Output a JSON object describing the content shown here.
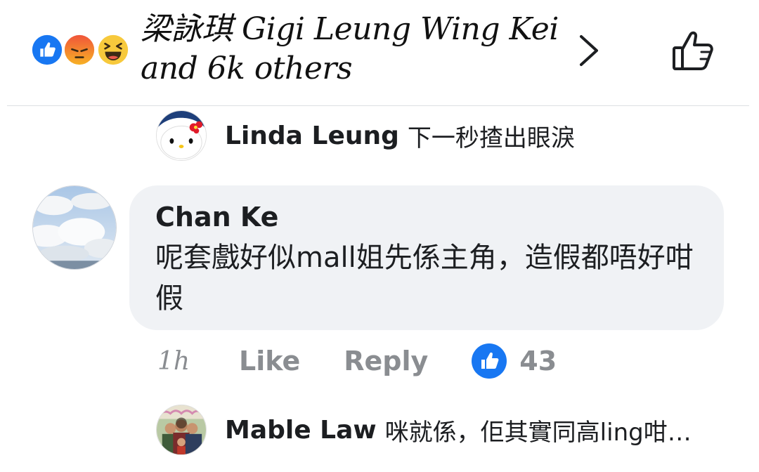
{
  "header": {
    "reactions": [
      "like",
      "angry",
      "haha"
    ],
    "reactors_text": "梁詠琪 Gigi Leung Wing Kei and 6k others",
    "next_icon": "chevron-right-icon",
    "like_icon": "thumbs-up-outline-icon"
  },
  "replies_top": {
    "name": "Linda Leung",
    "text": "下一秒揸出眼淚",
    "avatar": "hello-kitty-avatar"
  },
  "comment": {
    "author": "Chan Ke",
    "body": "呢套戲好似mall姐先係主角，造假都唔好咁假",
    "avatar": "sky-clouds-avatar"
  },
  "actions": {
    "time": "1h",
    "like_label": "Like",
    "reply_label": "Reply",
    "reaction_count": "43"
  },
  "replies_bottom": {
    "name": "Mable Law",
    "text": "咪就係，佢其實同高ling咁…",
    "avatar": "family-photo-avatar"
  },
  "colors": {
    "facebook_blue": "#1877f2",
    "bubble_bg": "#f0f2f5",
    "muted_text": "#8a8d91"
  }
}
